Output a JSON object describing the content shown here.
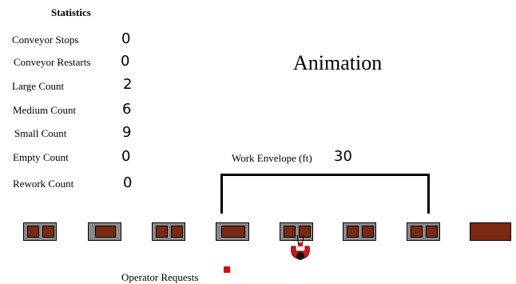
{
  "statistics": {
    "title": "Statistics",
    "items": [
      {
        "label": "Conveyor Stops",
        "value": "0"
      },
      {
        "label": "Conveyor Restarts",
        "value": "0"
      },
      {
        "label": "Large Count",
        "value": "2"
      },
      {
        "label": "Medium Count",
        "value": "6"
      },
      {
        "label": "Small Count",
        "value": "9"
      },
      {
        "label": "Empty Count",
        "value": "0"
      },
      {
        "label": "Rework Count",
        "value": "0"
      }
    ]
  },
  "animation": {
    "title": "Animation",
    "work_envelope_label": "Work Envelope (ft)",
    "work_envelope_value": "30",
    "operator_requests_label": "Operator Requests",
    "colors": {
      "station": "#8a8a8a",
      "part": "#7a2a12",
      "request_marker": "#e00000",
      "robot": "#d01818"
    }
  }
}
